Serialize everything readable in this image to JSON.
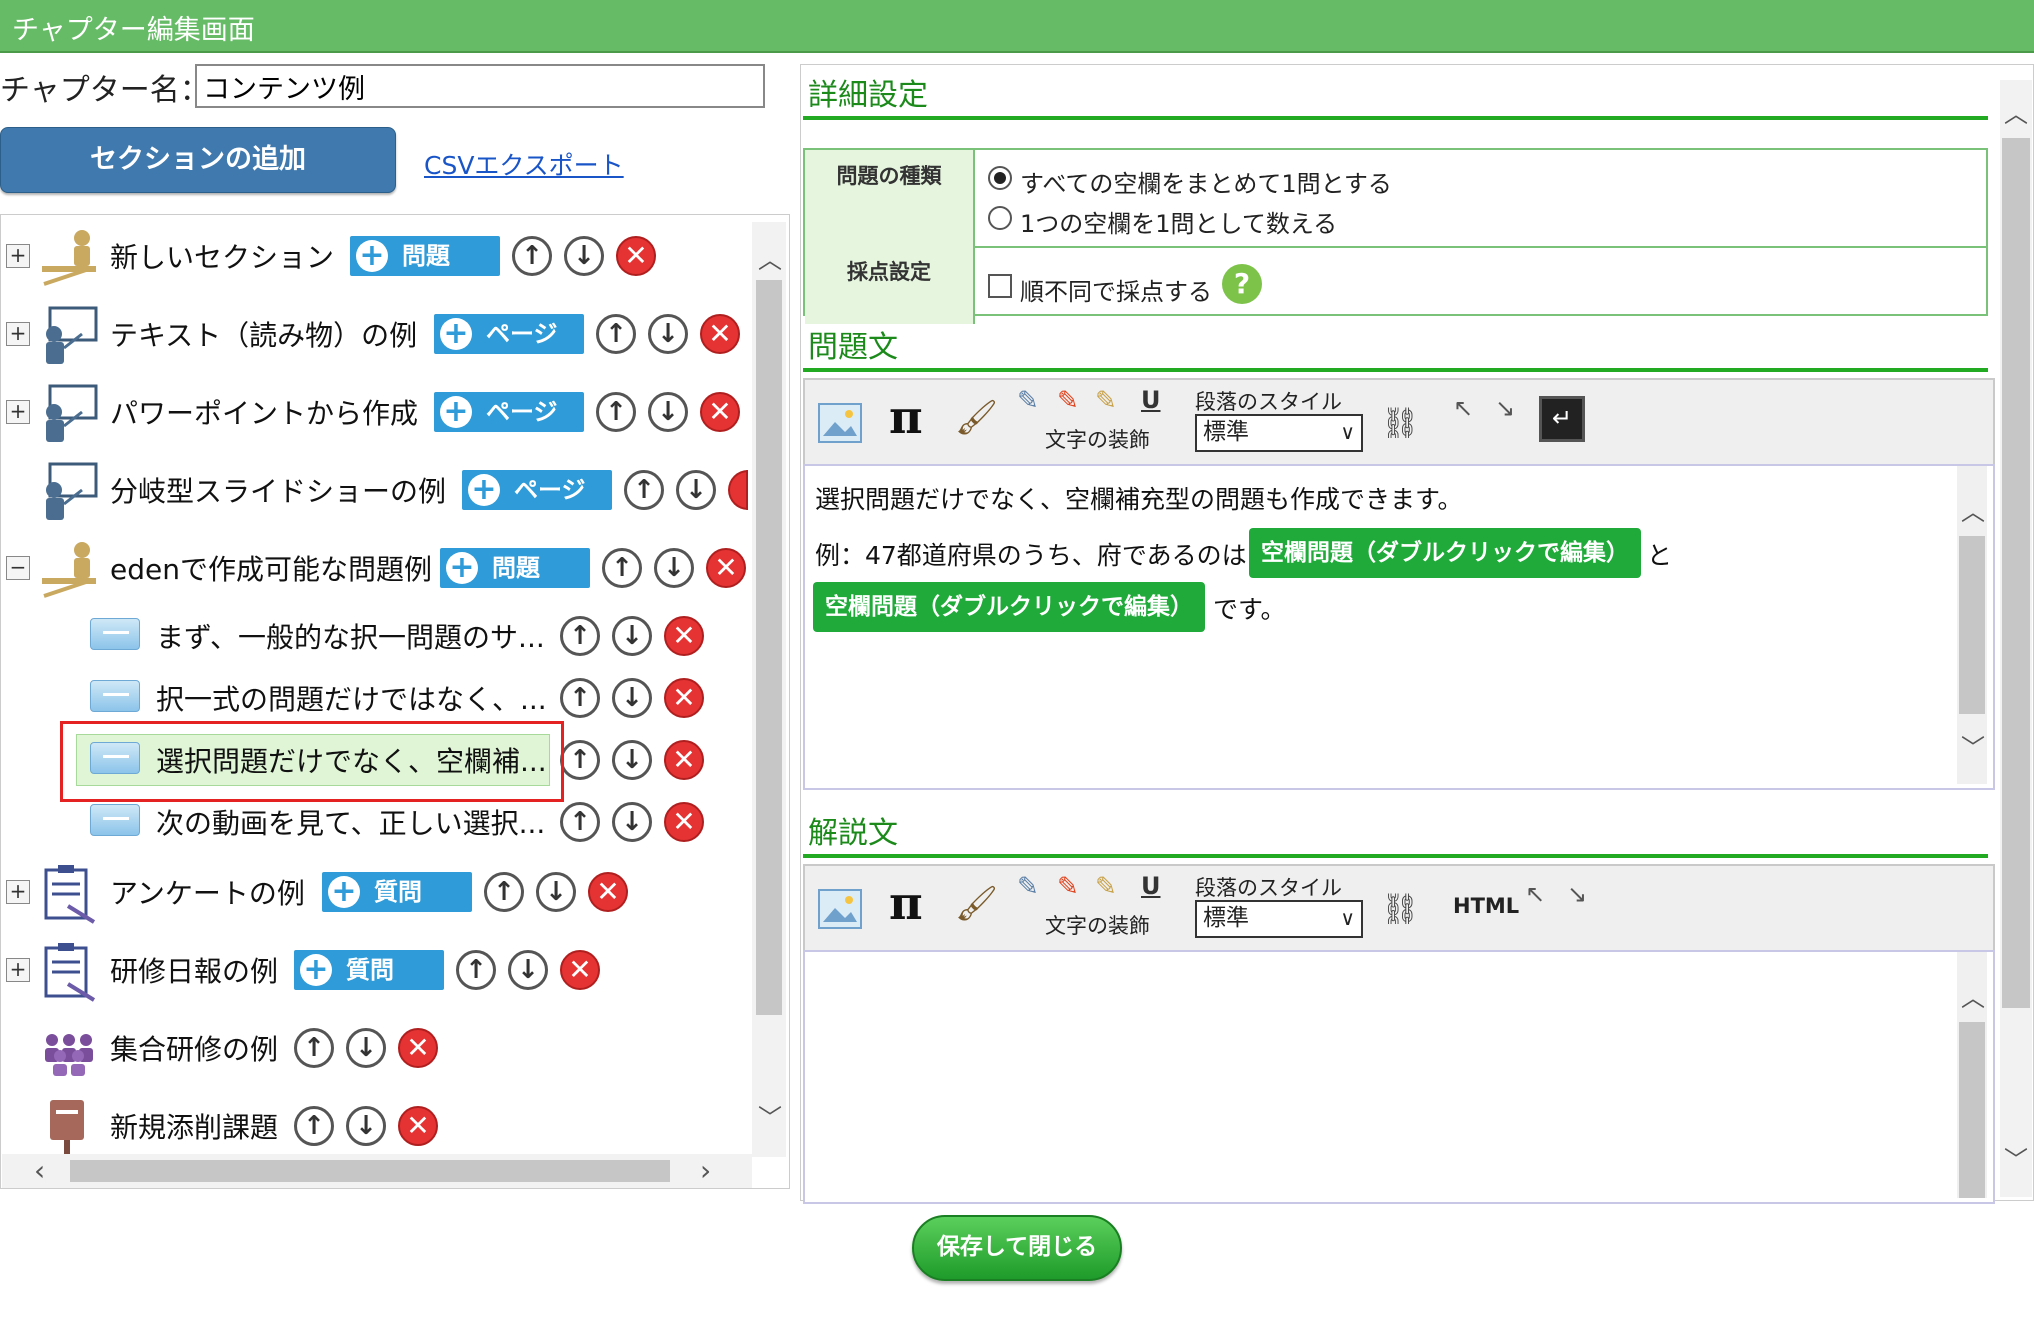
{
  "window": {
    "title": "チャプター編集画面"
  },
  "chapter": {
    "name_label": "チャプター名：",
    "name_value": "コンテンツ例"
  },
  "actions": {
    "add_section": "セクションの追加",
    "csv_export": "CSVエクスポート",
    "save_close": "保存して閉じる"
  },
  "tree": {
    "items": [
      {
        "label": "新しいセクション",
        "type_button": "問題",
        "icon": "lecturer-icon"
      },
      {
        "label": "テキスト（読み物）の例",
        "type_button": "ページ",
        "icon": "presenter-board-icon"
      },
      {
        "label": "パワーポイントから作成",
        "type_button": "ページ",
        "icon": "presenter-board-icon"
      },
      {
        "label": "分岐型スライドショーの例",
        "type_button": "ページ",
        "icon": "presenter-board-icon"
      },
      {
        "label": "edenで作成可能な問題例",
        "type_button": "問題",
        "icon": "lecturer-icon"
      },
      {
        "label": "アンケートの例",
        "type_button": "質問",
        "icon": "clipboard-icon"
      },
      {
        "label": "研修日報の例",
        "type_button": "質問",
        "icon": "clipboard-icon"
      },
      {
        "label": "集合研修の例",
        "icon": "group-people-icon"
      },
      {
        "label": "新規添削課題",
        "icon": "postbox-icon"
      }
    ],
    "children": [
      {
        "label": "まず、一般的な択一問題のサ..."
      },
      {
        "label": "択一式の問題だけではなく、..."
      },
      {
        "label": "選択問題だけでなく、空欄補..."
      },
      {
        "label": "次の動画を見て、正しい選択..."
      }
    ]
  },
  "detail": {
    "title": "詳細設定",
    "question_type": {
      "header": "問題の種類",
      "option1": "すべての空欄をまとめて1問とする",
      "option2": "1つの空欄を1問として数える",
      "selected": "option1"
    },
    "scoring": {
      "header": "採点設定",
      "option": "順不同で採点する",
      "checked": false,
      "help": "?"
    },
    "question_text": {
      "title": "問題文",
      "line1": "選択問題だけでなく、空欄補充型の問題も作成できます。",
      "line2_prefix": "例：47都道府県のうち、府であるのは",
      "blank1": "空欄問題（ダブルクリックで編集）",
      "connector": "と",
      "blank2": "空欄問題（ダブルクリックで編集）",
      "suffix": "です。"
    },
    "explanation": {
      "title": "解説文",
      "content": ""
    },
    "toolbar": {
      "para_style_label": "段落のスタイル",
      "decoration_label": "文字の装飾",
      "style_value": "標準",
      "pi": "π",
      "underline": "U",
      "html": "HTML"
    }
  },
  "colors": {
    "header_green": "#66bb66",
    "accent_green": "#22aa22",
    "type_button_blue": "#2f9bd8",
    "delete_red": "#e53333"
  }
}
